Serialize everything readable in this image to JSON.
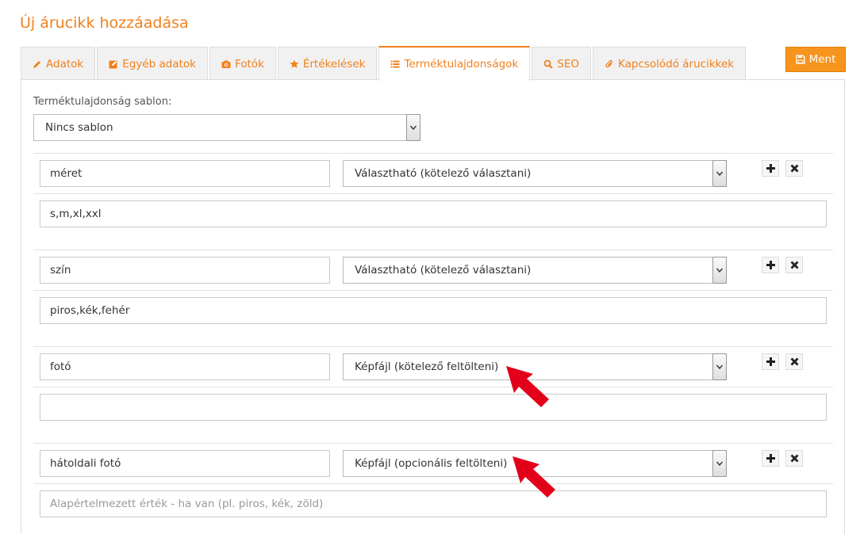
{
  "page": {
    "title": "Új árucikk hozzáadása"
  },
  "toolbar": {
    "save_label": "Ment"
  },
  "tabs": [
    {
      "label": "Adatok",
      "icon": "pencil-icon"
    },
    {
      "label": "Egyéb adatok",
      "icon": "edit-icon"
    },
    {
      "label": "Fotók",
      "icon": "camera-icon"
    },
    {
      "label": "Értékelések",
      "icon": "star-icon"
    },
    {
      "label": "Terméktulajdonságok",
      "icon": "list-icon",
      "active": true
    },
    {
      "label": "SEO",
      "icon": "search-icon"
    },
    {
      "label": "Kapcsolódó árucikkek",
      "icon": "paperclip-icon"
    }
  ],
  "template": {
    "label": "Terméktulajdonság sablon:",
    "selected": "Nincs sablon"
  },
  "properties": [
    {
      "name": "méret",
      "type": "Választható (kötelező választani)",
      "value": "s,m,xl,xxl",
      "placeholder": ""
    },
    {
      "name": "szín",
      "type": "Választható (kötelező választani)",
      "value": "piros,kék,fehér",
      "placeholder": ""
    },
    {
      "name": "fotó",
      "type": "Képfájl (kötelező feltölteni)",
      "value": "",
      "placeholder": ""
    },
    {
      "name": "hátoldali fotó",
      "type": "Képfájl (opcionális feltölteni)",
      "value": "",
      "placeholder": "Alapértelmezett érték - ha van (pl. piros, kék, zöld)"
    }
  ],
  "colors": {
    "accent": "#f0801b",
    "button": "#f7941d",
    "annotation_arrow": "#e3001b"
  }
}
